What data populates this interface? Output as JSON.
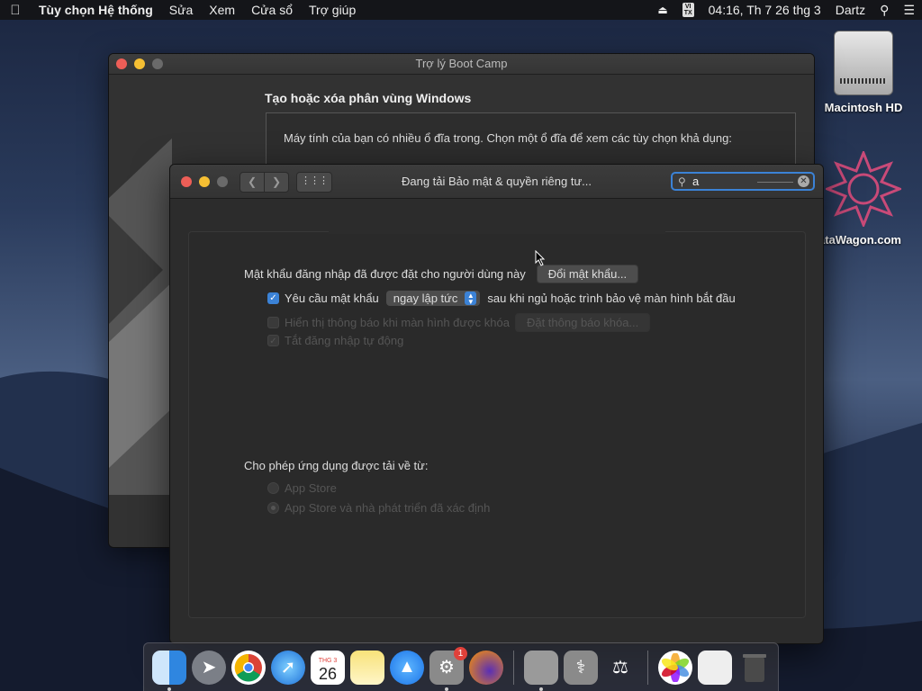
{
  "menubar": {
    "app_name": "Tùy chọn Hệ thống",
    "items": [
      "Sửa",
      "Xem",
      "Cửa sổ",
      "Trợ giúp"
    ],
    "input_method": "VI\nTX",
    "clock": "04:16, Th 7 26 thg 3",
    "user": "Dartz"
  },
  "desktop": {
    "disk_label": "Macintosh HD",
    "other_label": "ataWagon.com"
  },
  "bootcamp": {
    "title": "Trợ lý Boot Camp",
    "heading": "Tạo hoặc xóa phân vùng Windows",
    "message": "Máy tính của bạn có nhiều ổ đĩa trong. Chọn một ổ đĩa để xem các tùy chọn khả dụng:"
  },
  "security": {
    "title": "Đang tải Bảo mật & quyền riêng tư...",
    "search_value": "a",
    "password_label": "Mật khẩu đăng nhập đã được đặt cho người dùng này",
    "change_password_button": "Đổi mật khẩu...",
    "require_password_label": "Yêu cầu mật khẩu",
    "require_password_checked": true,
    "require_password_select": "ngay lập tức",
    "require_password_suffix": "sau khi ngủ hoặc trình bảo vệ màn hình bắt đầu",
    "show_message_label": "Hiển thị thông báo khi màn hình được khóa",
    "set_lock_message_button": "Đặt thông báo khóa...",
    "disable_autologin_label": "Tắt đăng nhập tự động",
    "allow_apps_label": "Cho phép ứng dụng được tải về từ:",
    "option_app_store": "App Store",
    "option_app_store_identified": "App Store và nhà phát triển đã xác định"
  },
  "dock": {
    "calendar_month": "THG 3",
    "calendar_day": "26",
    "sysprefs_badge": "1"
  }
}
